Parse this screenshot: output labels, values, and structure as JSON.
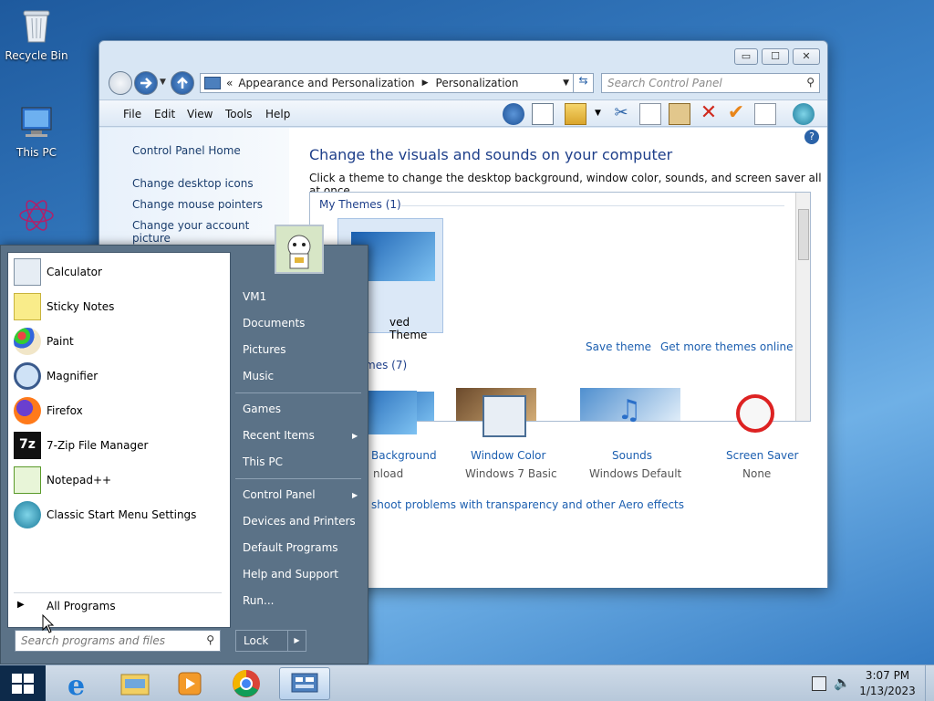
{
  "desktop": {
    "recycle_bin": "Recycle Bin",
    "this_pc": "This PC"
  },
  "window": {
    "minimize": "▭",
    "maximize": "☐",
    "close": "✕",
    "breadcrumb_prefix": "«",
    "breadcrumb": [
      "Appearance and Personalization",
      "Personalization"
    ],
    "search_placeholder": "Search Control Panel",
    "menu": [
      "File",
      "Edit",
      "View",
      "Tools",
      "Help"
    ],
    "left_links": [
      "Control Panel Home",
      "Change desktop icons",
      "Change mouse pointers",
      "Change your account picture"
    ],
    "title": "Change the visuals and sounds on your computer",
    "subtitle": "Click a theme to change the desktop background, window color, sounds, and screen saver all at once.",
    "my_themes": "My Themes (1)",
    "unsaved_theme": "ved Theme",
    "save_theme": "Save theme",
    "get_more_themes": "Get more themes online",
    "aero_themes": "mes (7)",
    "bottom_items": [
      {
        "title": "Background",
        "sub": "nload"
      },
      {
        "title": "Window Color",
        "sub": "Windows 7 Basic"
      },
      {
        "title": "Sounds",
        "sub": "Windows Default"
      },
      {
        "title": "Screen Saver",
        "sub": "None"
      }
    ],
    "troubleshoot": "shoot problems with transparency and other Aero effects"
  },
  "start_menu": {
    "programs": [
      "Calculator",
      "Sticky Notes",
      "Paint",
      "Magnifier",
      "Firefox",
      "7-Zip File Manager",
      "Notepad++",
      "Classic Start Menu Settings"
    ],
    "all_programs": "All Programs",
    "search_placeholder": "Search programs and files",
    "right_group1": [
      "VM1",
      "Documents",
      "Pictures",
      "Music"
    ],
    "right_group2": [
      "Games",
      "Recent Items",
      "This PC"
    ],
    "right_group3": [
      "Control Panel",
      "Devices and Printers",
      "Default Programs",
      "Help and Support",
      "Run..."
    ],
    "lock": "Lock"
  },
  "taskbar": {
    "time": "3:07 PM",
    "date": "1/13/2023"
  },
  "colors": {
    "link_blue": "#1c5fb0",
    "heading_blue": "#1e3f8a",
    "start_menu_bg": "#5b7287"
  }
}
